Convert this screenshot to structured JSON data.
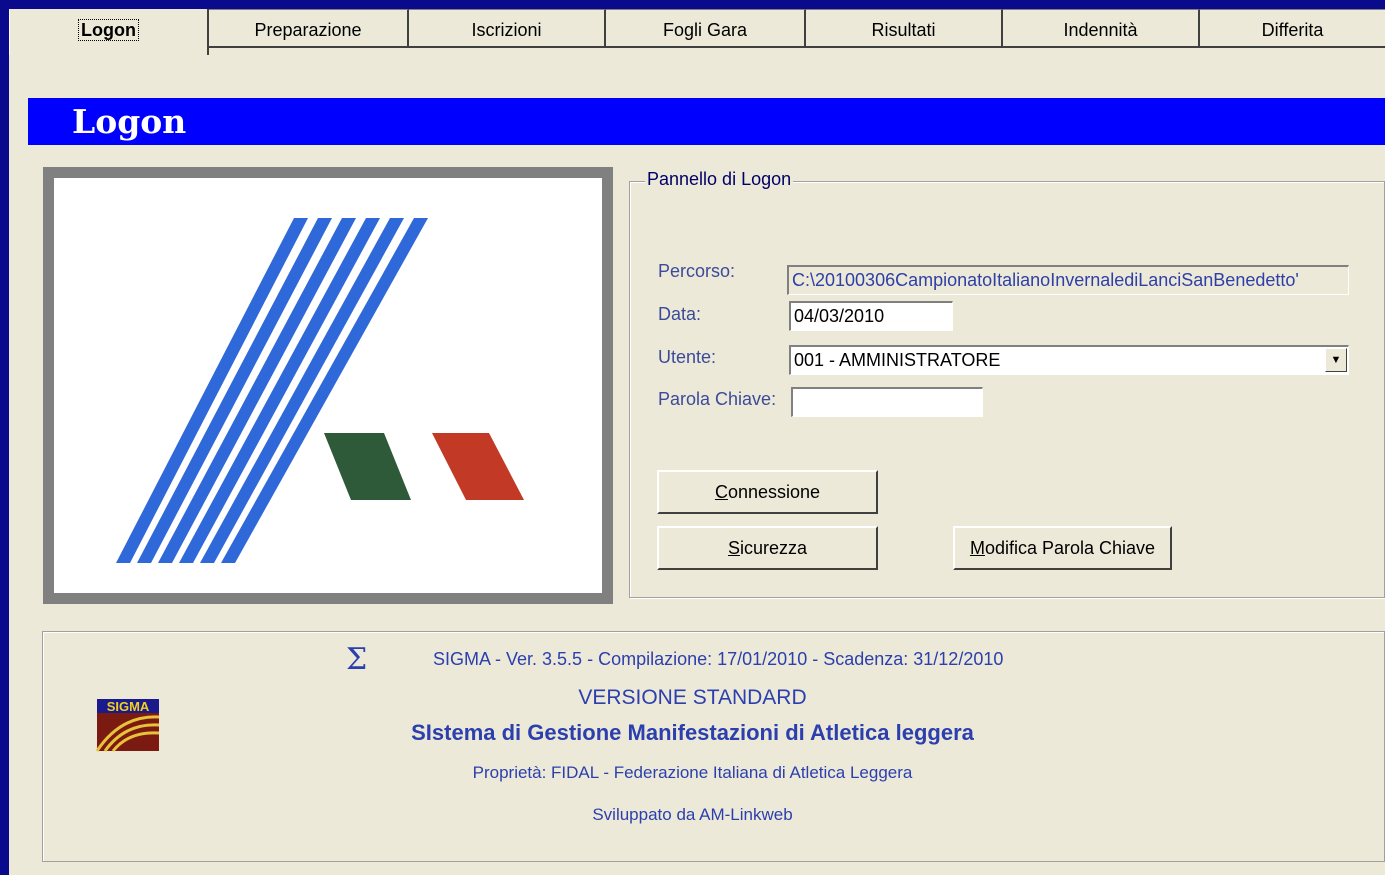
{
  "tabs": [
    {
      "label": "Logon",
      "active": true
    },
    {
      "label": "Preparazione"
    },
    {
      "label": "Iscrizioni"
    },
    {
      "label": "Fogli Gara"
    },
    {
      "label": "Risultati"
    },
    {
      "label": "Indennità"
    },
    {
      "label": "Differita"
    }
  ],
  "page_title": "Logon",
  "logon_panel": {
    "legend": "Pannello di Logon",
    "percorso_label": "Percorso:",
    "percorso_value": "C:\\20100306CampionatoItalianoInvernalediLanciSanBenedetto'",
    "data_label": "Data:",
    "data_value": "04/03/2010",
    "utente_label": "Utente:",
    "utente_value": "001 - AMMINISTRATORE",
    "password_label": "Parola Chiave:",
    "password_value": ""
  },
  "buttons": {
    "connessione_ul": "C",
    "connessione_rest": "onnessione",
    "sicurezza_ul": "S",
    "sicurezza_rest": "icurezza",
    "modifica_ul": "M",
    "modifica_rest": "odifica Parola Chiave"
  },
  "info": {
    "sigma_symbol": "Σ",
    "version_line": "SIGMA  - Ver. 3.5.5  -  Compilazione: 17/01/2010 - Scadenza: 31/12/2010",
    "edition": "VERSIONE STANDARD",
    "system_name": "SIstema di Gestione Manifestazioni di Atletica leggera",
    "owner": "Proprietà: FIDAL - Federazione Italiana di Atletica Leggera",
    "developer": "Sviluppato da AM-Linkweb",
    "logo_text": "SIGMA"
  },
  "colors": {
    "title_bar": "#0000ff",
    "background": "#0a0a8c",
    "panel": "#ece9d8",
    "logo_blue": "#2f68d8",
    "logo_green": "#2f5a3a",
    "logo_red": "#c23a25"
  }
}
